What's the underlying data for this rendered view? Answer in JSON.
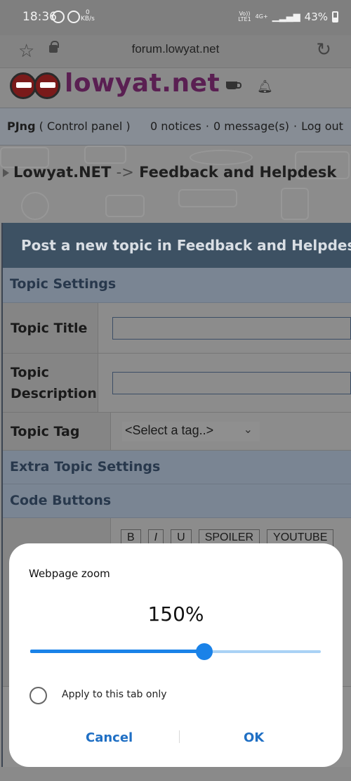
{
  "status_bar": {
    "time": "18:36",
    "speed_value": "0",
    "speed_unit": "KB/s",
    "network_top": "Vo))",
    "network_bottom": "LTE1",
    "network_type": "4G+",
    "battery": "43%"
  },
  "browser": {
    "url": "forum.lowyat.net",
    "bookmark_icon": "star-icon",
    "lock_icon": "lock-icon",
    "reload_icon": "reload-icon"
  },
  "site": {
    "logo_text": "lowyat.net",
    "coffee_icon": "coffee-cup-icon",
    "bell_icon": "bell-icon"
  },
  "user_bar": {
    "username": "PJng",
    "control_panel": "( Control panel )",
    "notices": "0 notices",
    "messages": "0 message(s)",
    "logout": "Log out",
    "separator": "·"
  },
  "breadcrumb": {
    "root": "Lowyat.NET",
    "arrow": "->",
    "current": "Feedback and Helpdesk"
  },
  "form": {
    "title": "Post a new topic in Feedback and Helpdesk",
    "topic_settings": "Topic Settings",
    "topic_title_label": "Topic Title",
    "topic_title_value": "",
    "topic_description_label": "Topic Description",
    "topic_description_value": "",
    "topic_tag_label": "Topic Tag",
    "topic_tag_selected": "<Select a tag..>",
    "extra_topic_settings": "Extra Topic Settings",
    "code_buttons": "Code Buttons",
    "code_button_labels": [
      "B",
      "I",
      "U",
      "SPOILER",
      "YOUTUBE"
    ]
  },
  "dialog": {
    "title": "Webpage zoom",
    "zoom_value": "150%",
    "slider_fraction": 0.6,
    "checkbox_label": "Apply to this tab only",
    "checkbox_checked": false,
    "cancel_label": "Cancel",
    "ok_label": "OK",
    "accent_color": "#1a82e8"
  }
}
